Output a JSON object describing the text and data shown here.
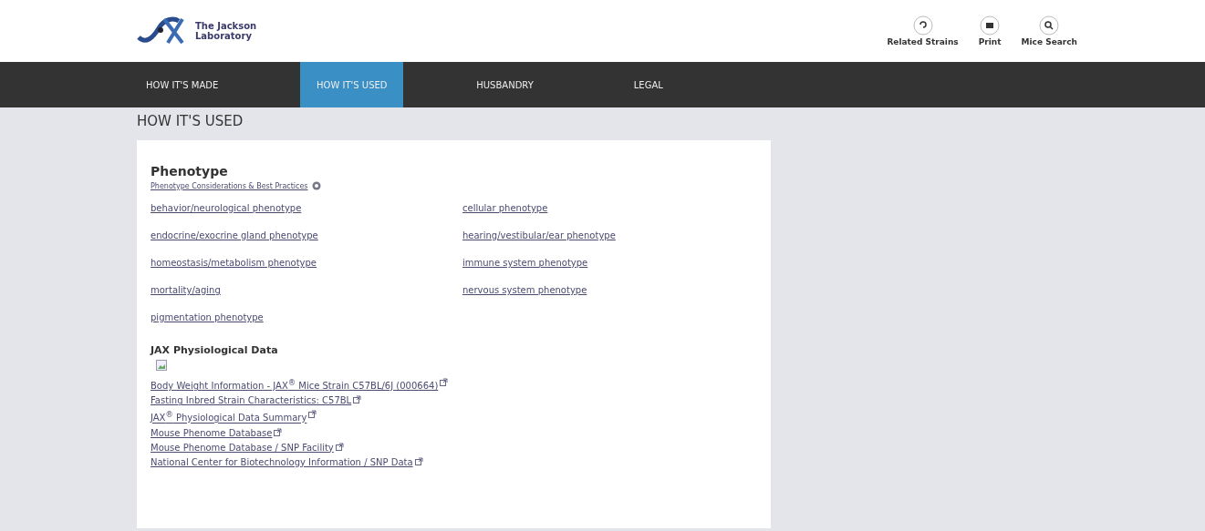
{
  "header": {
    "logo_text": [
      "The Jackson",
      "Laboratory"
    ],
    "tools": [
      {
        "kind": "related",
        "label": "Related Strains"
      },
      {
        "kind": "print",
        "label": "Print"
      },
      {
        "kind": "search",
        "label": "Mice Search"
      }
    ]
  },
  "nav": {
    "tabs": [
      {
        "label": "HOW IT'S MADE",
        "selected": false
      },
      {
        "label": "HOW IT'S USED",
        "selected": true
      },
      {
        "label": "HUSBANDRY",
        "selected": false
      },
      {
        "label": "LEGAL",
        "selected": false
      }
    ]
  },
  "page_title": "HOW IT'S USED",
  "phenotype": {
    "title": "Phenotype",
    "help_link": "Phenotype Considerations & Best Practices",
    "links": [
      "behavior/neurological phenotype",
      "cellular phenotype",
      "endocrine/exocrine gland phenotype",
      "hearing/vestibular/ear phenotype",
      "homeostasis/metabolism phenotype",
      "immune system phenotype",
      "mortality/aging",
      "nervous system phenotype",
      "pigmentation phenotype"
    ]
  },
  "physiological": {
    "title": "JAX Physiological Data",
    "links": [
      "Body Weight Information - JAX$^{®}$ Mice Strain C57BL/6J (000664)",
      "Fasting Inbred Strain Characteristics: C57BL",
      "JAX$^{®}$ Physiological Data Summary",
      "Mouse Phenome Database",
      "Mouse Phenome Database / SNP Facility",
      "National Center for Biotechnology Information / SNP Data"
    ]
  }
}
